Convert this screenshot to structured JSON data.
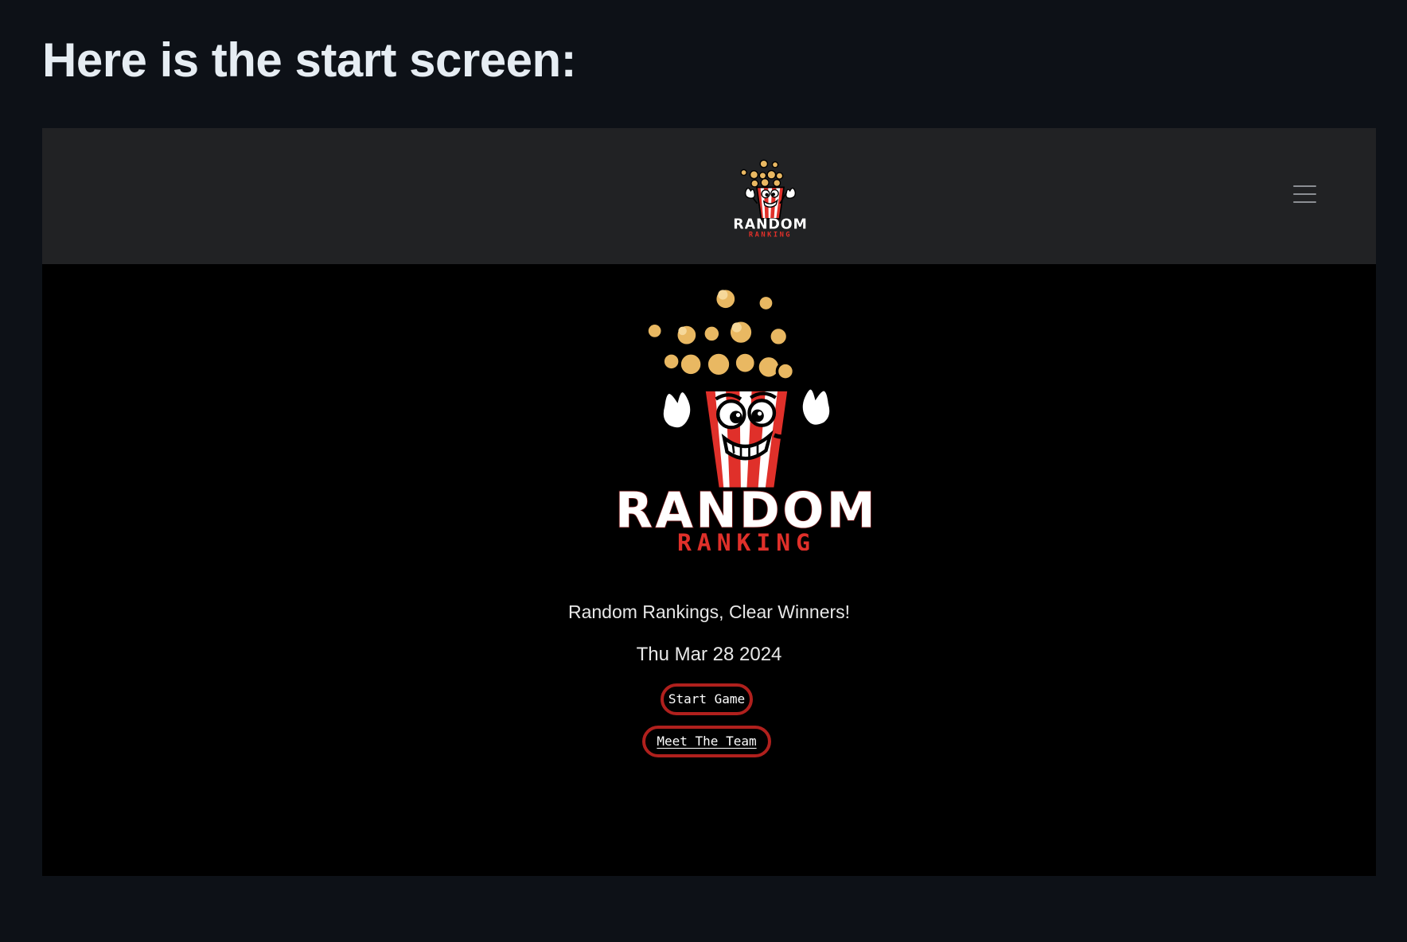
{
  "heading": "Here is the start screen:",
  "app": {
    "logo": {
      "line1": "RANDOM",
      "line2": "RANKING"
    },
    "menu_icon": "hamburger-menu-icon",
    "tagline": "Random Rankings, Clear Winners!",
    "date": "Thu Mar 28 2024",
    "buttons": {
      "start_game": "Start Game",
      "meet_team": "Meet The Team"
    }
  },
  "colors": {
    "page_background": "#0d1117",
    "navbar_background": "#212224",
    "app_background": "#000000",
    "brand_red": "#e0302a",
    "button_border": "#b0201d",
    "popcorn": "#e9b862"
  }
}
